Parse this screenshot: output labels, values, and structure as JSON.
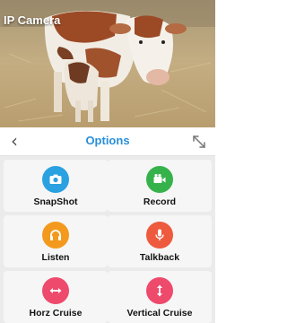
{
  "video": {
    "title": "IP Camera"
  },
  "options_bar": {
    "title": "Options"
  },
  "buttons": [
    {
      "label": "SnapShot",
      "icon": "camera-icon",
      "color": "#2aa1e0"
    },
    {
      "label": "Record",
      "icon": "video-camera-icon",
      "color": "#36b24b"
    },
    {
      "label": "Listen",
      "icon": "headphones-icon",
      "color": "#f39a1e"
    },
    {
      "label": "Talkback",
      "icon": "microphone-icon",
      "color": "#ee5a3d"
    },
    {
      "label": "Horz Cruise",
      "icon": "horizontal-arrows-icon",
      "color": "#ee4a6c"
    },
    {
      "label": "Vertical Cruise",
      "icon": "vertical-arrows-icon",
      "color": "#ee4a6c"
    }
  ]
}
